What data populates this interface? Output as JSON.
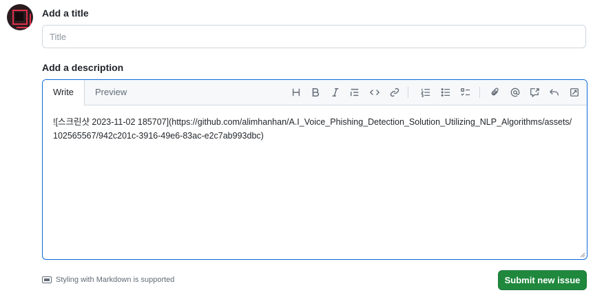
{
  "title_section": {
    "label": "Add a title",
    "placeholder": "Title",
    "value": ""
  },
  "description_section": {
    "label": "Add a description",
    "tabs": [
      {
        "label": "Write",
        "active": true
      },
      {
        "label": "Preview",
        "active": false
      }
    ],
    "toolbar_icons": [
      "heading-icon",
      "bold-icon",
      "italic-icon",
      "quote-icon",
      "code-icon",
      "link-icon",
      "numbered-list-icon",
      "unordered-list-icon",
      "task-list-icon",
      "attach-icon",
      "mention-icon",
      "reference-icon",
      "undo-icon",
      "fullscreen-icon"
    ],
    "text": "![스크린샷 2023-11-02 185707](https://github.com/alimhanhan/A.I_Voice_Phishing_Detection_Solution_Utilizing_NLP_Algorithms/assets/102565567/942c201c-3916-49e6-83ac-e2c7ab993dbc)"
  },
  "footer": {
    "markdown_note": "Styling with Markdown is supported",
    "submit_label": "Submit new issue"
  },
  "colors": {
    "accent_blue": "#0969da",
    "submit_green": "#1f883d",
    "avatar_red": "#e0314b"
  }
}
